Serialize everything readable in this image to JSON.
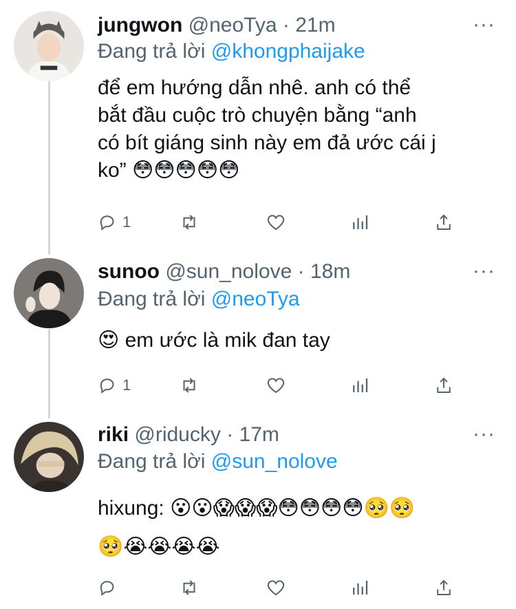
{
  "tweets": [
    {
      "name": "jungwon",
      "handle": "@neoTya",
      "sep": "·",
      "time": "21m",
      "reply_prefix": "Đang trả lời",
      "reply_to": "@khongphaijake",
      "body_lines": [
        "để em hướng dẫn nhê. anh có thể",
        "bắt đầu cuộc trò chuyện bằng “anh",
        "có bít giáng sinh này em đả ước cái j",
        "ko” 😳😳😳😳😳"
      ],
      "reply_count": "1",
      "more": "···"
    },
    {
      "name": "sunoo",
      "handle": "@sun_nolove",
      "sep": "·",
      "time": "18m",
      "reply_prefix": "Đang trả lời",
      "reply_to": "@neoTya",
      "body_lines": [
        "😍 em ước là mik đan tay"
      ],
      "reply_count": "1",
      "more": "···"
    },
    {
      "name": "riki",
      "handle": "@riducky",
      "sep": "·",
      "time": "17m",
      "reply_prefix": "Đang trả lời",
      "reply_to": "@sun_nolove",
      "body_lines": [
        "hixung: 😮😮😱😱😱😳😳😳😳🥺🥺",
        "🥺😭😭😭😭"
      ],
      "reply_count": "",
      "more": "···"
    }
  ],
  "icons": [
    "reply-icon",
    "retweet-icon",
    "like-icon",
    "analytics-icon",
    "share-icon",
    "more-icon"
  ],
  "colors": {
    "text": "#0f1419",
    "muted": "#536471",
    "link": "#1d9bf0",
    "thread": "#cfd9de"
  }
}
